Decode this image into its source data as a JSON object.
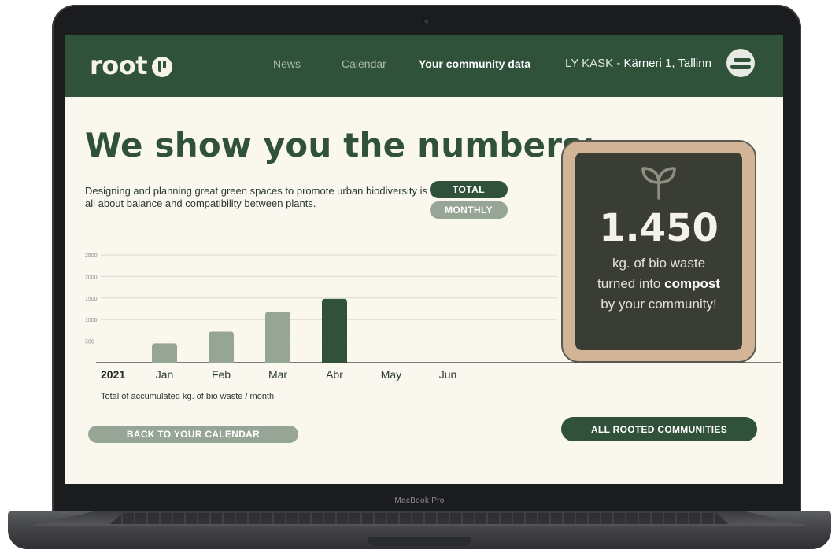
{
  "device": {
    "label": "MacBook Pro"
  },
  "nav": {
    "logo_text": "root",
    "links": [
      {
        "label": "News",
        "active": false
      },
      {
        "label": "Calendar",
        "active": false
      },
      {
        "label": "Your community data",
        "active": true
      }
    ],
    "location_prefix": "LY KASK - ",
    "location_address": "Kärneri 1, Tallinn"
  },
  "main": {
    "headline": "We show you the numbers:",
    "description": "Designing and planning great green spaces to promote urban biodiversity is all about balance and compatibility between plants.",
    "toggle": {
      "total_label": "TOTAL",
      "monthly_label": "MONTHLY",
      "selected": "TOTAL"
    },
    "caption": "Total of accumulated kg. of bio waste / month",
    "back_button": "BACK TO YOUR CALENDAR",
    "all_button": "ALL ROOTED COMMUNITIES"
  },
  "stat_card": {
    "value": "1.450",
    "line1": "kg. of bio waste",
    "line2_prefix": "turned into ",
    "line2_bold": "compost",
    "line3": "by your community!",
    "icon": "sprout-icon"
  },
  "colors": {
    "brand_green": "#30523a",
    "muted_green": "#97a596",
    "background": "#f9f7ee",
    "card_frame": "#d2b497",
    "card_dark": "#3a3d33"
  },
  "chart_data": {
    "type": "bar",
    "year_label": "2021",
    "categories": [
      "Jan",
      "Feb",
      "Mar",
      "Abr",
      "May",
      "Jun"
    ],
    "values": [
      450,
      720,
      1180,
      1480,
      null,
      null
    ],
    "highlight_index": 3,
    "yticks": [
      500,
      1000,
      1500,
      2000,
      2500
    ],
    "ylim": [
      0,
      2500
    ],
    "grid": true,
    "xlabel": "",
    "ylabel": ""
  }
}
